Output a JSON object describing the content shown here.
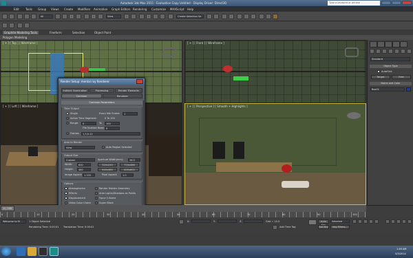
{
  "titlebar": {
    "title": "Autodesk 3ds Max 2011 - Evaluation Copy   Untitled - Display Driver: Direct3D",
    "search_placeholder": "Type a keyword or phrase"
  },
  "menubar": {
    "items": [
      "Edit",
      "Tools",
      "Group",
      "Views",
      "Create",
      "Modifiers",
      "Animation",
      "Graph Editors",
      "Rendering",
      "Customize",
      "MAXScript",
      "Help"
    ]
  },
  "toolbar": {
    "selection_filter": "All",
    "view_dropdown": "View",
    "selection_set_dropdown": "Create Selection Se"
  },
  "ribbon": {
    "tabs": [
      "Graphite Modeling Tools",
      "Freeform",
      "Selection",
      "Object Paint"
    ],
    "sub": "Polygon Modeling"
  },
  "viewports": {
    "top": "[ + ] [ Top ] [ Wireframe ]",
    "front": "[ + ] [ Front ] [ Wireframe ]",
    "left": "[ + ] [ Left ] [ Wireframe ]",
    "perspective": "[ + ] [ Perspective ] [ Smooth + Highlights ]"
  },
  "command_panel": {
    "dropdown": "Standard",
    "object_type_header": "Object Type",
    "autogrid_label": "AutoGrid",
    "buttons": [
      "Target",
      "Free"
    ],
    "name_color_header": "Name and Color",
    "name_value": "Box01"
  },
  "render_dialog": {
    "title": "Render Setup: mental ray Renderer",
    "tabs_row1": [
      "Indirect Illumination",
      "Processing",
      "Render Elements"
    ],
    "tabs_row2": [
      "Common",
      "Renderer"
    ],
    "rollout_header": "Common Parameters",
    "time_output": {
      "label": "Time Output",
      "single": "Single",
      "every_nth_label": "Every Nth Frame:",
      "every_nth_value": "1",
      "active_segment": "Active Time Segment:",
      "active_segment_value": "0 To 100",
      "range": "Range:",
      "range_from": "0",
      "range_to_label": "To",
      "range_to": "100",
      "file_number_label": "File Number Base:",
      "file_number_value": "0",
      "frames": "Frames",
      "frames_value": "1,3,5-12"
    },
    "area_to_render": {
      "label": "Area to Render",
      "value": "View",
      "auto_region": "Auto Region Selected"
    },
    "output_size": {
      "label": "Output Size",
      "preset": "Custom",
      "aperture_label": "Aperture Width(mm):",
      "aperture_value": "36.0",
      "width_label": "Width:",
      "width_value": "640",
      "height_label": "Height:",
      "height_value": "480",
      "presets": [
        "320x240",
        "720x486",
        "640x480",
        "800x600"
      ],
      "image_aspect_label": "Image Aspect:",
      "image_aspect_value": "1.333",
      "pixel_aspect_label": "Pixel Aspect:",
      "pixel_aspect_value": "1.0"
    },
    "options": {
      "label": "Options",
      "left": [
        "Atmospherics",
        "Effects",
        "Displacement",
        "Video Color Check",
        "Render to Fields"
      ],
      "right": [
        "Render Hidden Geometry",
        "Area Lights/Shadows as Points",
        "Force 2-Sided",
        "Super Black"
      ]
    },
    "footer": {
      "mode": "Production",
      "preset_label": "Preset:",
      "preset_value": "--------------------",
      "activeshade": "ActiveShade",
      "view_label": "View:",
      "view_value": "Perspective",
      "render_button": "Render"
    }
  },
  "timeline": {
    "slider": "0 / 100",
    "ticks": [
      "0",
      "10",
      "20",
      "30",
      "40",
      "50",
      "60",
      "70",
      "80",
      "90",
      "100"
    ]
  },
  "status": {
    "objects": "1 Object Selected",
    "maxscript": "Welcome to M",
    "rendering_time": "Rendering Time: 0:00:01",
    "translation_time": "Translation Time: 0:00:01",
    "add_time_tag": "Add Time Tag",
    "x_label": "X:",
    "y_label": "Y:",
    "z_label": "Z:",
    "grid": "Grid = 10.0",
    "auto_key": "Auto Key",
    "selected": "Selected",
    "set_key": "Set Key",
    "key_filters": "Key Filters..."
  },
  "taskbar": {
    "clock_time": "1:46 AM",
    "clock_date": "5/3/2014"
  },
  "colors": {
    "viewport_active_border": "#c9b845",
    "titlebar": "#4a6a8c",
    "close_button": "#c4453a"
  }
}
